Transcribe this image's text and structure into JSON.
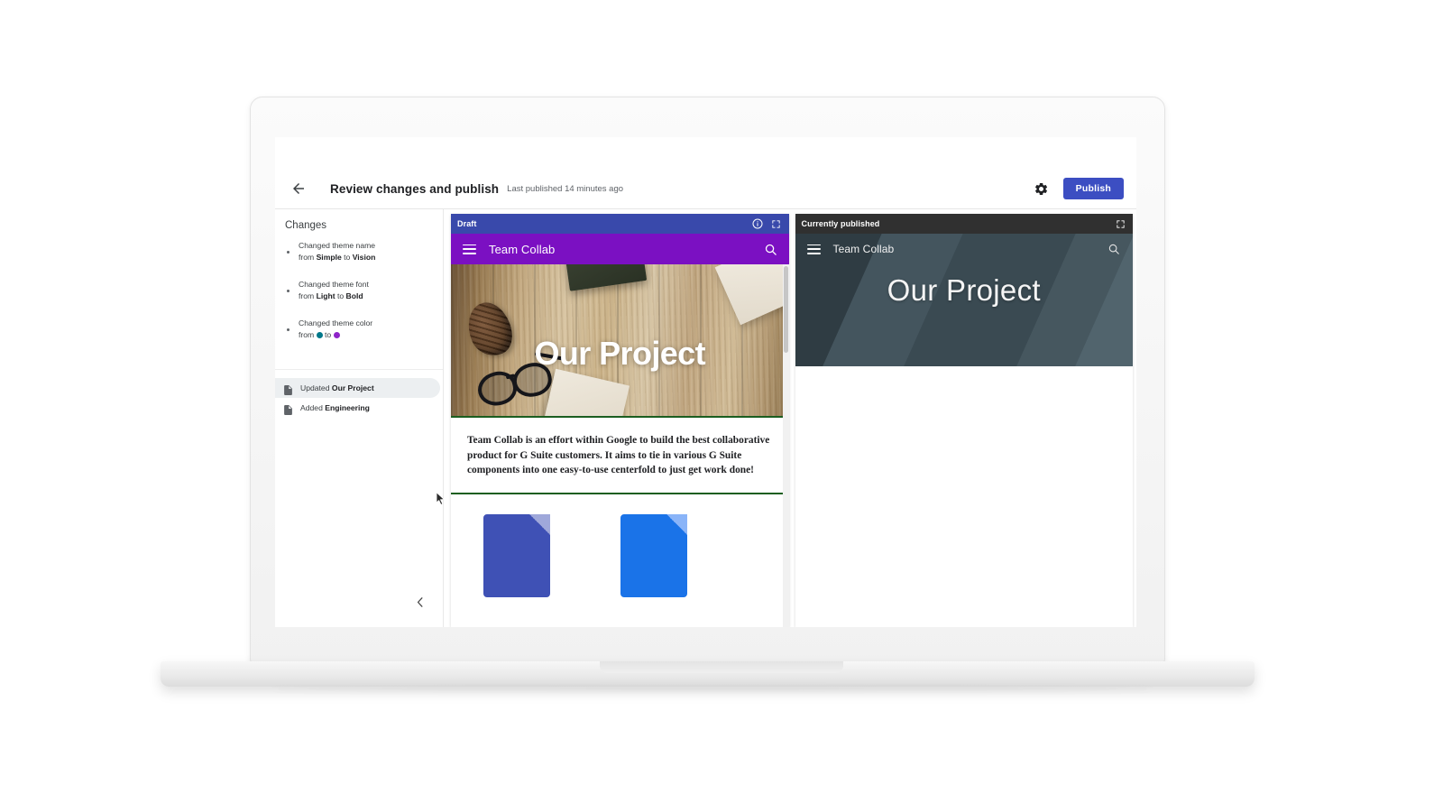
{
  "app": {
    "header": {
      "back_icon": "back-arrow-icon",
      "title": "Review changes and publish",
      "subtitle": "Last published 14 minutes ago",
      "settings_icon": "gear-icon",
      "publish_label": "Publish",
      "publish_color": "#3c4ec2"
    }
  },
  "sidebar": {
    "title": "Changes",
    "changes": [
      {
        "prefix": "Changed theme name",
        "line2_pre": "from ",
        "bold1": "Simple",
        "mid": " to ",
        "bold2": "Vision",
        "type": "text"
      },
      {
        "prefix": "Changed theme font",
        "line2_pre": "from ",
        "bold1": "Light",
        "mid": " to ",
        "bold2": "Bold",
        "type": "text"
      },
      {
        "prefix": "Changed theme color",
        "line2_pre": "from ",
        "mid": " to ",
        "type": "color",
        "from_color": "#00788a",
        "to_color": "#8e24c9"
      }
    ],
    "items": [
      {
        "label_prefix": "Updated ",
        "label_bold": "Our Project",
        "icon": "document-icon",
        "selected": true
      },
      {
        "label_prefix": "Added ",
        "label_bold": "Engineering",
        "icon": "document-icon",
        "selected": false
      }
    ],
    "collapse_icon": "chevron-left-icon"
  },
  "draft_pane": {
    "bar_title": "Draft",
    "bar_color": "#3949ab",
    "info_icon": "info-icon",
    "fullscreen_icon": "fullscreen-icon",
    "site": {
      "menu_icon": "hamburger-menu-icon",
      "name": "Team Collab",
      "search_icon": "search-icon",
      "bar_color": "#7b10c2",
      "hero_title": "Our Project",
      "hero_style": "wood-photo",
      "accent_line_color": "#1b5e20",
      "body_text": "Team Collab is an effort within Google to build the best collaborative product for G Suite customers. It aims to tie in various G Suite components into one easy-to-use centerfold to just get work done!",
      "cards": [
        {
          "name": "google-docs-file-icon",
          "color": "#3f51b5"
        },
        {
          "name": "google-docs-file-icon",
          "color": "#1a73e8"
        }
      ]
    }
  },
  "published_pane": {
    "bar_title": "Currently published",
    "bar_color": "#303030",
    "fullscreen_icon": "fullscreen-icon",
    "site": {
      "menu_icon": "hamburger-menu-icon",
      "name": "Team Collab",
      "search_icon": "search-icon",
      "hero_title": "Our Project",
      "hero_style": "slate-geometric"
    }
  }
}
